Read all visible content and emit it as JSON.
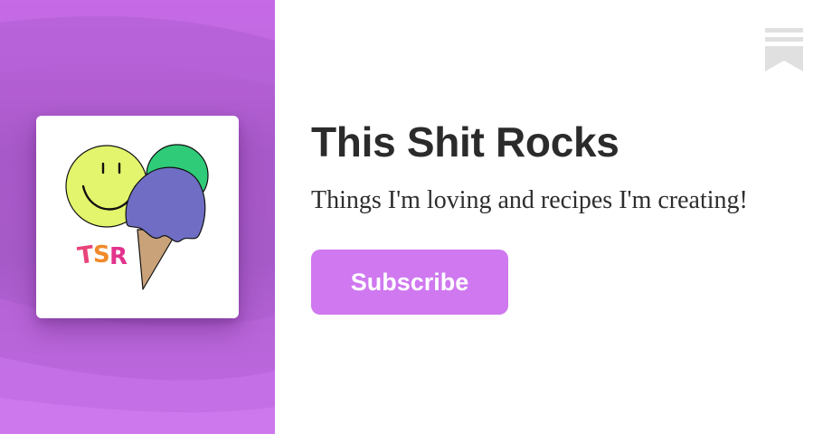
{
  "publication": {
    "title": "This Shit Rocks",
    "tagline": "Things I'm loving and recipes I'm creating!",
    "logo": {
      "letters": [
        "T",
        "S",
        "R"
      ],
      "letter_colors": [
        "#e8457a",
        "#f08a2a",
        "#e2338c"
      ],
      "smiley_color": "#e3f56c",
      "scoop_colors": [
        "#2fcb79",
        "#6f6ec4"
      ],
      "cone_color": "#c9a27a"
    }
  },
  "actions": {
    "subscribe_label": "Subscribe"
  },
  "icons": {
    "brand": "substack-bookmark-icon"
  },
  "colors": {
    "accent": "#cf78f0",
    "side_panel": "#b060d4",
    "title_text": "#2b2b2b",
    "logo_mark": "#e0e0e0"
  }
}
